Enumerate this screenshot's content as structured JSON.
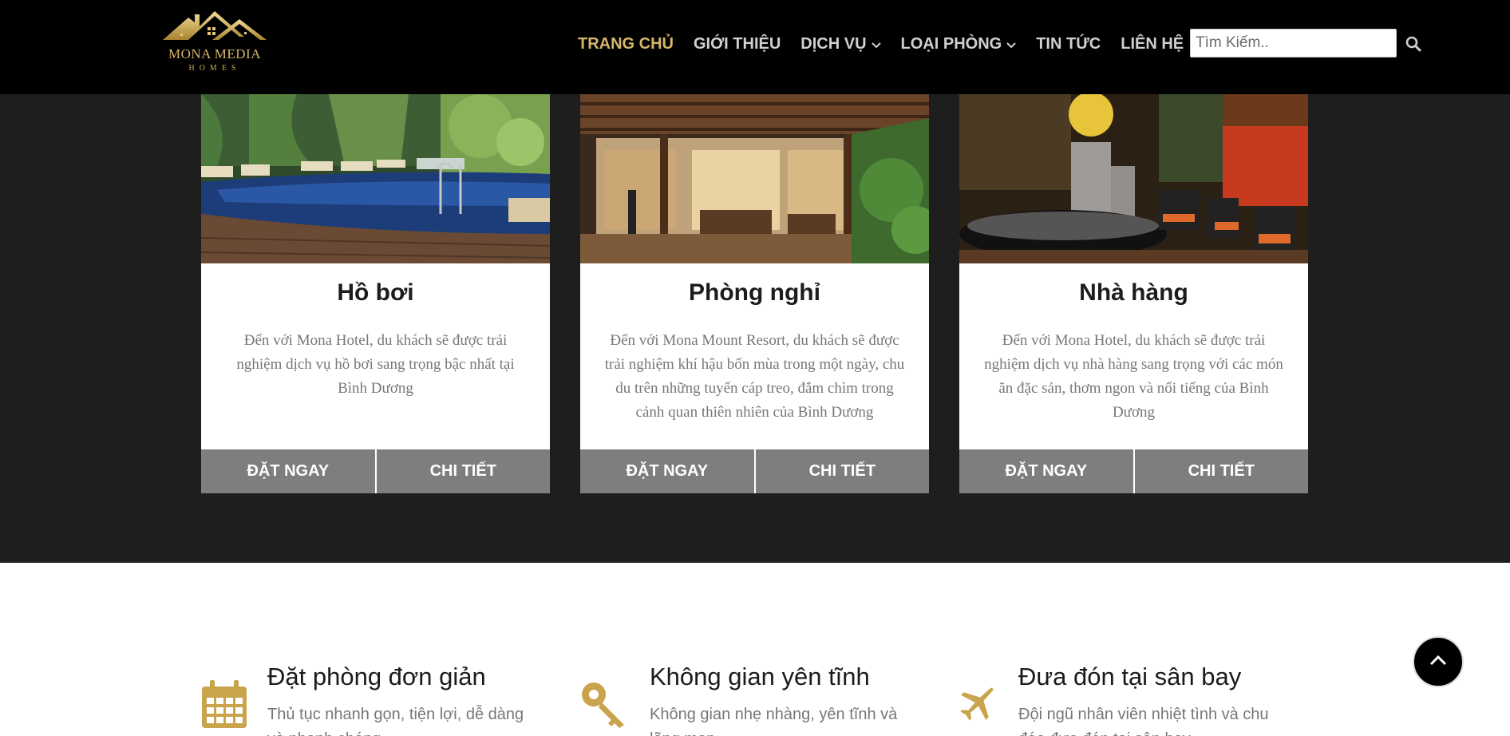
{
  "logo": {
    "name": "MONA MEDIA",
    "sub": "HOMES"
  },
  "nav": {
    "items": [
      {
        "label": "TRANG CHỦ",
        "active": true,
        "has_dropdown": false
      },
      {
        "label": "GIỚI THIỆU",
        "active": false,
        "has_dropdown": false
      },
      {
        "label": "DỊCH VỤ",
        "active": false,
        "has_dropdown": true
      },
      {
        "label": "LOẠI PHÒNG",
        "active": false,
        "has_dropdown": true
      },
      {
        "label": "TIN TỨC",
        "active": false,
        "has_dropdown": false
      },
      {
        "label": "LIÊN HỆ",
        "active": false,
        "has_dropdown": false
      }
    ],
    "search_placeholder": "Tìm Kiếm.."
  },
  "services": [
    {
      "title": "Hồ bơi",
      "desc": "Đến với Mona Hotel, du khách sẽ được trải nghiệm dịch vụ hồ bơi sang trọng bậc nhất tại Bình Dương",
      "book_label": "ĐẶT NGAY",
      "detail_label": "CHI TIẾT",
      "image": "pool-photo"
    },
    {
      "title": "Phòng nghỉ",
      "desc": "Đến với Mona Mount Resort, du khách sẽ được trải nghiệm khí hậu bốn mùa trong một ngày, chu du trên những tuyến cáp treo, đắm chìm trong cảnh quan thiên nhiên của Bình Dương",
      "book_label": "ĐẶT NGAY",
      "detail_label": "CHI TIẾT",
      "image": "room-patio-photo"
    },
    {
      "title": "Nhà hàng",
      "desc": "Đến với Mona Hotel, du khách sẽ được trải nghiệm dịch vụ nhà hàng sang trọng với các món ăn đặc sản, thơm ngon và nổi tiếng của Bình Dương",
      "book_label": "ĐẶT NGAY",
      "detail_label": "CHI TIẾT",
      "image": "restaurant-photo"
    }
  ],
  "features": [
    {
      "icon": "calendar-icon",
      "title": "Đặt phòng đơn giản",
      "desc": "Thủ tục nhanh gọn, tiện lợi, dễ dàng và nhanh chóng"
    },
    {
      "icon": "key-icon",
      "title": "Không gian yên tĩnh",
      "desc": "Không gian nhẹ nhàng, yên tĩnh và lãng mạn"
    },
    {
      "icon": "airplane-icon",
      "title": "Đưa đón tại sân bay",
      "desc": "Đội ngũ nhân viên nhiệt tình và chu đáo đưa đón tại sân bay"
    }
  ],
  "colors": {
    "accent": "#d8b66a",
    "header_bg": "#000000",
    "section_bg": "#1e1e1e",
    "button_bg": "#7e7e7e",
    "icon_gold": "#c9a44c"
  }
}
